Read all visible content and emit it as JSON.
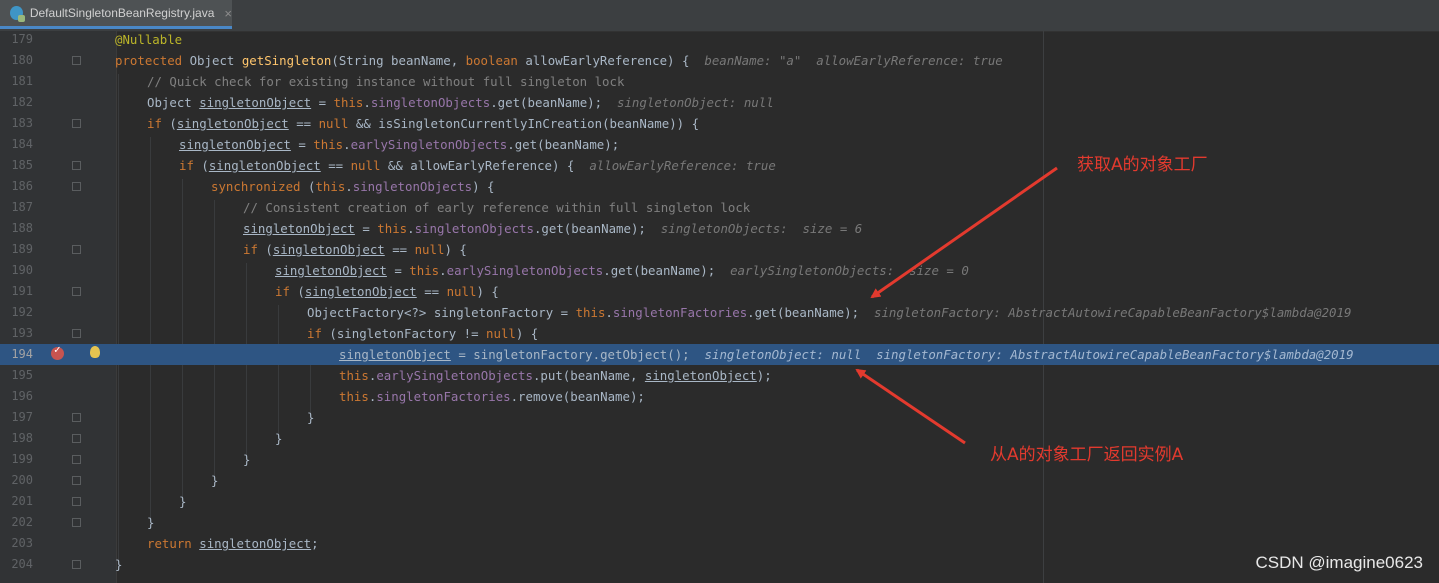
{
  "tab": {
    "filename": "DefaultSingletonBeanRegistry.java",
    "close": "×"
  },
  "lines": [
    {
      "n": "179"
    },
    {
      "n": "180"
    },
    {
      "n": "181"
    },
    {
      "n": "182"
    },
    {
      "n": "183"
    },
    {
      "n": "184"
    },
    {
      "n": "185"
    },
    {
      "n": "186"
    },
    {
      "n": "187"
    },
    {
      "n": "188"
    },
    {
      "n": "189"
    },
    {
      "n": "190"
    },
    {
      "n": "191"
    },
    {
      "n": "192"
    },
    {
      "n": "193"
    },
    {
      "n": "194"
    },
    {
      "n": "195"
    },
    {
      "n": "196"
    },
    {
      "n": "197"
    },
    {
      "n": "198"
    },
    {
      "n": "199"
    },
    {
      "n": "200"
    },
    {
      "n": "201"
    },
    {
      "n": "202"
    },
    {
      "n": "203"
    },
    {
      "n": "204"
    }
  ],
  "code": {
    "l179": "@Nullable",
    "l180_kw": "protected",
    "l180_a": " Object ",
    "l180_fn": "getSingleton",
    "l180_b": "(String beanName, ",
    "l180_kw2": "boolean",
    "l180_c": " allowEarlyReference) {  ",
    "l180_inlay": "beanName: \"a\"  allowEarlyReference: true",
    "l181": "// Quick check for existing instance without full singleton lock",
    "l182_a": "Object ",
    "l182_v": "singletonObject",
    "l182_b": " = ",
    "l182_kw": "this",
    "l182_c": ".",
    "l182_f": "singletonObjects",
    "l182_d": ".get(beanName);  ",
    "l182_inlay": "singletonObject: null",
    "l183_kw": "if",
    "l183_a": " (",
    "l183_v": "singletonObject",
    "l183_b": " == ",
    "l183_kw2": "null",
    "l183_c": " && isSingletonCurrentlyInCreation(beanName)) {",
    "l184_v": "singletonObject",
    "l184_a": " = ",
    "l184_kw": "this",
    "l184_b": ".",
    "l184_f": "earlySingletonObjects",
    "l184_c": ".get(beanName);",
    "l185_kw": "if",
    "l185_a": " (",
    "l185_v": "singletonObject",
    "l185_b": " == ",
    "l185_kw2": "null",
    "l185_c": " && allowEarlyReference) {  ",
    "l185_inlay": "allowEarlyReference: true",
    "l186_kw": "synchronized",
    "l186_a": " (",
    "l186_kw2": "this",
    "l186_b": ".",
    "l186_f": "singletonObjects",
    "l186_c": ") {",
    "l187": "// Consistent creation of early reference within full singleton lock",
    "l188_v": "singletonObject",
    "l188_a": " = ",
    "l188_kw": "this",
    "l188_b": ".",
    "l188_f": "singletonObjects",
    "l188_c": ".get(beanName);  ",
    "l188_inlay": "singletonObjects:  size = 6",
    "l189_kw": "if",
    "l189_a": " (",
    "l189_v": "singletonObject",
    "l189_b": " == ",
    "l189_kw2": "null",
    "l189_c": ") {",
    "l190_v": "singletonObject",
    "l190_a": " = ",
    "l190_kw": "this",
    "l190_b": ".",
    "l190_f": "earlySingletonObjects",
    "l190_c": ".get(beanName);  ",
    "l190_inlay": "earlySingletonObjects:  size = 0",
    "l191_kw": "if",
    "l191_a": " (",
    "l191_v": "singletonObject",
    "l191_b": " == ",
    "l191_kw2": "null",
    "l191_c": ") {",
    "l192_a": "ObjectFactory<?> singletonFactory = ",
    "l192_kw": "this",
    "l192_b": ".",
    "l192_f": "singletonFactories",
    "l192_c": ".get(beanName);  ",
    "l192_inlay": "singletonFactory: AbstractAutowireCapableBeanFactory$lambda@2019",
    "l193_kw": "if",
    "l193_a": " (singletonFactory != ",
    "l193_kw2": "null",
    "l193_b": ") {",
    "l194_v": "singletonObject",
    "l194_a": " = singletonFactory.getObject();  ",
    "l194_inlay": "singletonObject: null  singletonFactory: AbstractAutowireCapableBeanFactory$lambda@2019",
    "l195_kw": "this",
    "l195_a": ".",
    "l195_f": "earlySingletonObjects",
    "l195_b": ".put(beanName, ",
    "l195_v": "singletonObject",
    "l195_c": ");",
    "l196_kw": "this",
    "l196_a": ".",
    "l196_f": "singletonFactories",
    "l196_b": ".remove(beanName);",
    "brace": "}",
    "l203_kw": "return",
    "l203_a": " ",
    "l203_v": "singletonObject",
    "l203_b": ";"
  },
  "annotations": {
    "top": "获取A的对象工厂",
    "bottom": "从A的对象工厂返回实例A",
    "color": "#e33a2e"
  },
  "watermark": "CSDN @imagine0623",
  "icons": [
    "java-class-icon",
    "breakpoint-icon",
    "lightbulb-icon",
    "fold-icon"
  ]
}
